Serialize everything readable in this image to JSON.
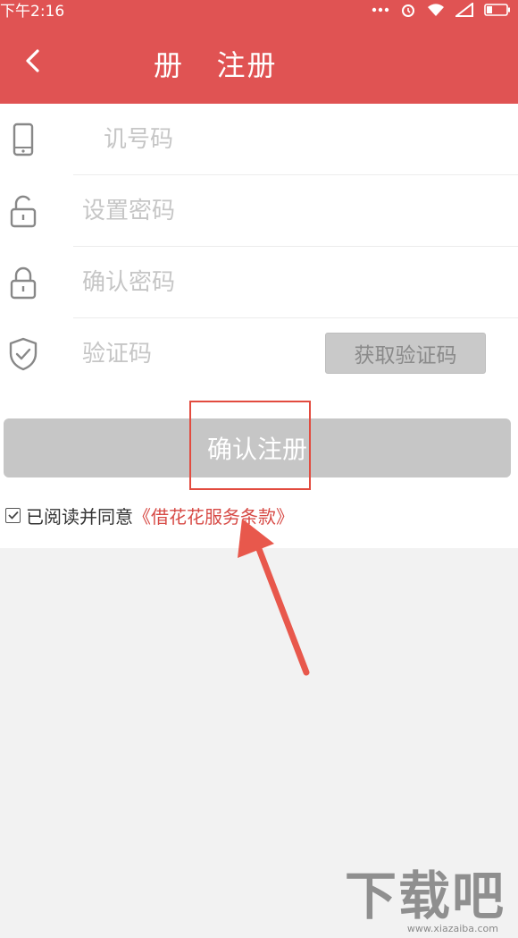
{
  "status_bar": {
    "time": "下午2:16"
  },
  "header": {
    "title": "册   注册"
  },
  "form": {
    "phone_placeholder": "讥号码",
    "password_placeholder": "设置密码",
    "confirm_password_placeholder": "确认密码",
    "code_placeholder": "验证码",
    "get_code_label": "获取验证码"
  },
  "submit_label": "确认注册",
  "agreement": {
    "text": "已阅读并同意",
    "link": "《借花花服务条款》",
    "checked": true
  },
  "colors": {
    "brand": "#e05353",
    "button_disabled": "#c6c6c6",
    "annotation": "#e24b3f"
  },
  "watermark": {
    "main": "下载吧",
    "sub": "www.xiazaiba.com"
  }
}
